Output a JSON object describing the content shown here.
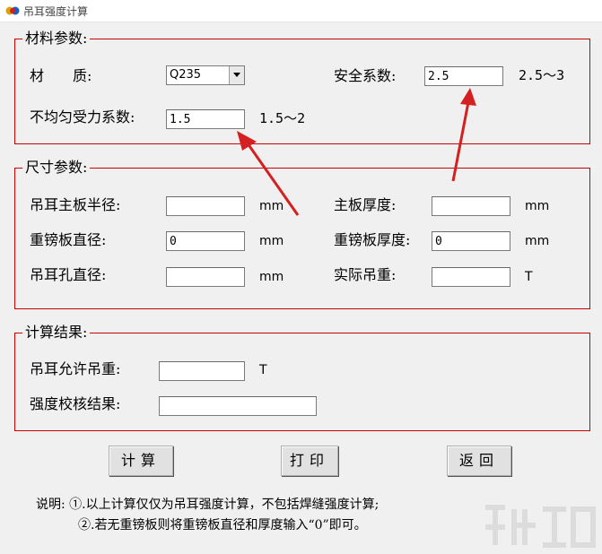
{
  "window": {
    "title": "吊耳强度计算"
  },
  "material": {
    "legend": "材料参数:",
    "material_label": "材　　质:",
    "material_value": "Q235",
    "safety_label": "安全系数:",
    "safety_value": "2.5",
    "safety_range": "2.5～3",
    "uneven_label": "不均匀受力系数:",
    "uneven_value": "1.5",
    "uneven_range": "1.5～2"
  },
  "size": {
    "legend": "尺寸参数:",
    "main_radius_label": "吊耳主板半径:",
    "main_radius_value": "",
    "main_radius_unit": "mm",
    "main_thick_label": "主板厚度:",
    "main_thick_value": "",
    "main_thick_unit": "mm",
    "pad_dia_label": "重镑板直径:",
    "pad_dia_value": "0",
    "pad_dia_unit": "mm",
    "pad_thick_label": "重镑板厚度:",
    "pad_thick_value": "0",
    "pad_thick_unit": "mm",
    "hole_dia_label": "吊耳孔直径:",
    "hole_dia_value": "",
    "hole_dia_unit": "mm",
    "actual_load_label": "实际吊重:",
    "actual_load_value": "",
    "actual_load_unit": "T"
  },
  "result": {
    "legend": "计算结果:",
    "allow_label": "吊耳允许吊重:",
    "allow_value": "",
    "allow_unit": "T",
    "check_label": "强度校核结果:",
    "check_value": ""
  },
  "buttons": {
    "calc": "计算",
    "print": "打印",
    "back": "返回"
  },
  "notes": {
    "line1": "说明: ①.以上计算仅仅为吊耳强度计算，不包括焊缝强度计算;",
    "line2": "②.若无重镑板则将重镑板直径和厚度输入“0”即可。"
  },
  "colors": {
    "frame": "#c80000",
    "arrow": "#d42020",
    "background": "#f0f0f0"
  },
  "icons": {
    "app": "app-logo-icon",
    "dropdown": "chevron-down-icon",
    "watermark": "site-watermark-icon"
  }
}
